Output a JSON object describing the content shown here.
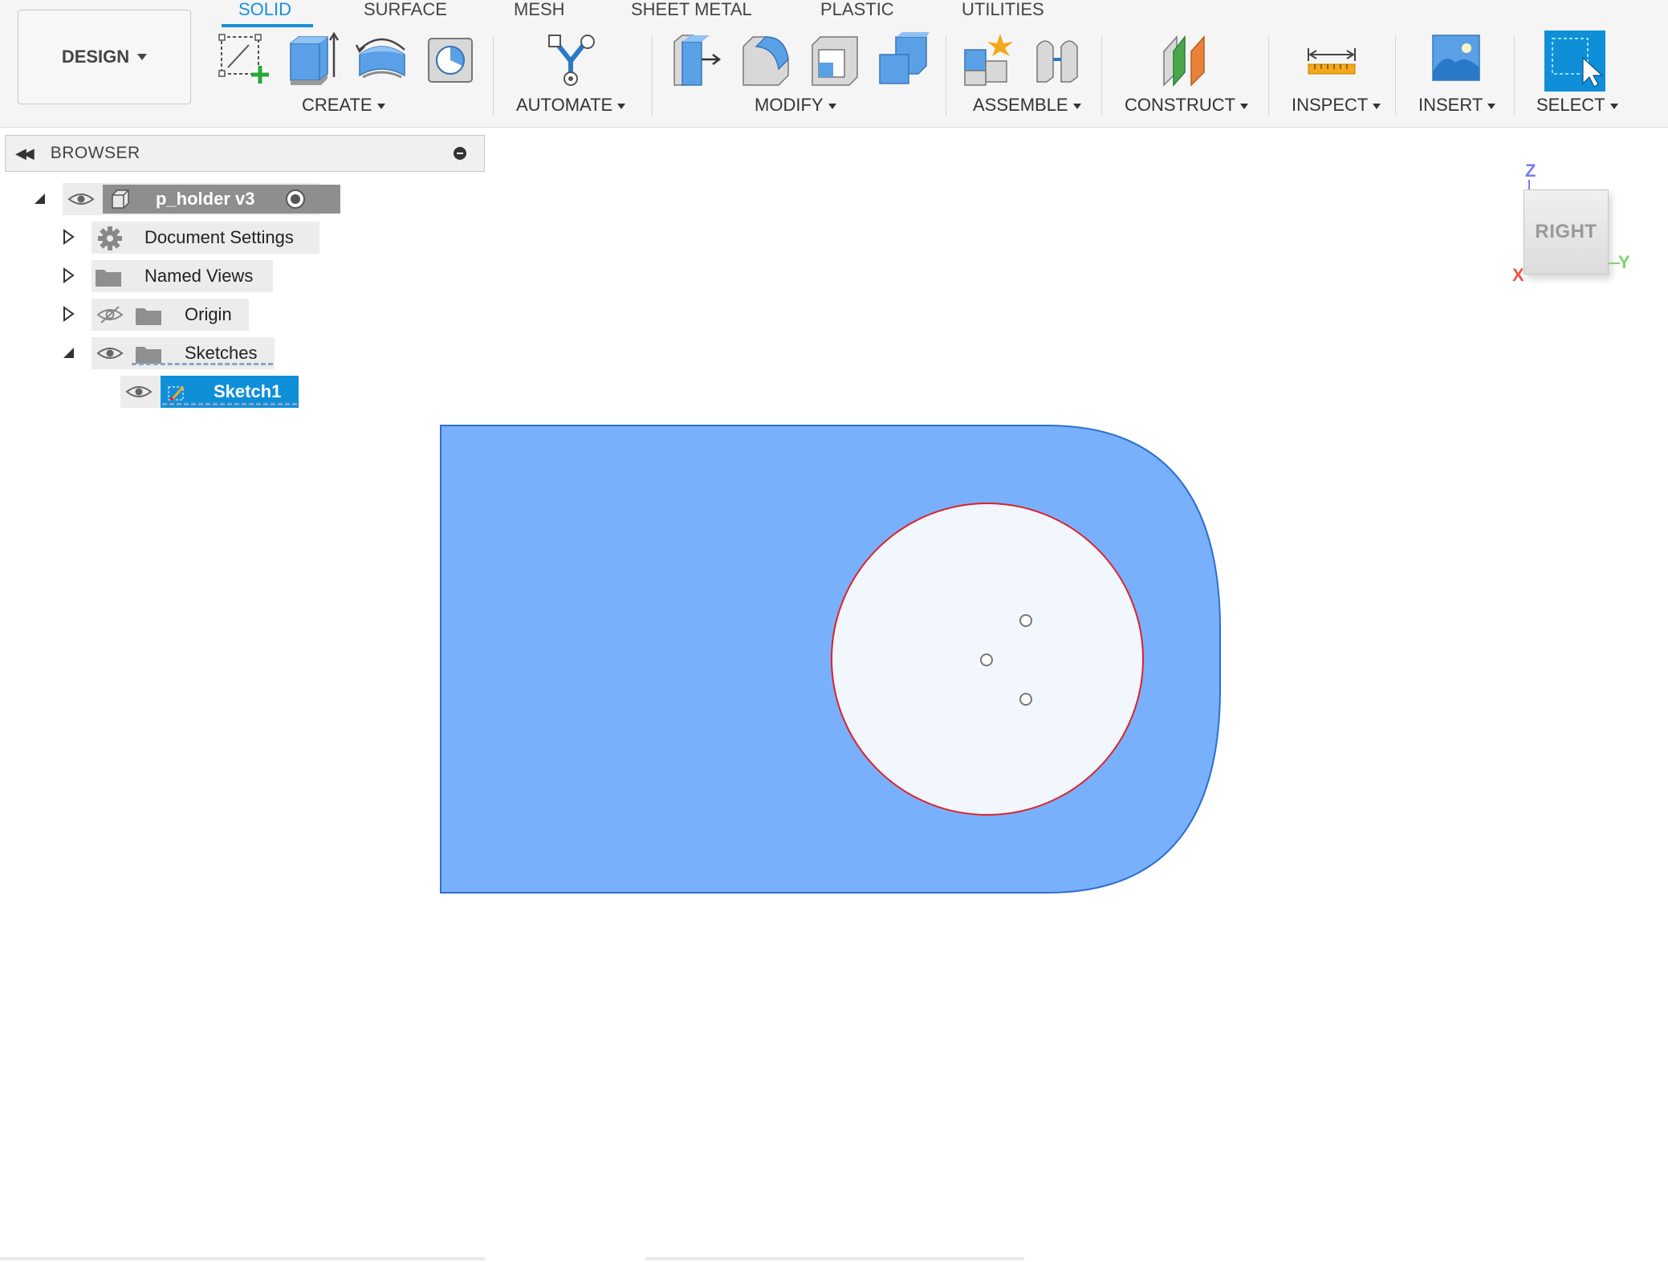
{
  "toolbar": {
    "design_label": "DESIGN",
    "tabs": [
      {
        "label": "SOLID",
        "active": true
      },
      {
        "label": "SURFACE"
      },
      {
        "label": "MESH"
      },
      {
        "label": "SHEET METAL"
      },
      {
        "label": "PLASTIC"
      },
      {
        "label": "UTILITIES"
      }
    ],
    "groups": {
      "create": "CREATE",
      "automate": "AUTOMATE",
      "modify": "MODIFY",
      "assemble": "ASSEMBLE",
      "construct": "CONSTRUCT",
      "inspect": "INSPECT",
      "insert": "INSERT",
      "select": "SELECT"
    },
    "icons": {
      "create": [
        "create-sketch-icon",
        "extrude-icon",
        "revolve-icon",
        "hole-icon"
      ],
      "automate": [
        "automate-icon"
      ],
      "modify": [
        "press-pull-icon",
        "fillet-icon",
        "shell-icon",
        "combine-icon"
      ],
      "assemble": [
        "new-component-icon",
        "joint-icon"
      ],
      "construct": [
        "construct-plane-icon"
      ],
      "inspect": [
        "measure-icon"
      ],
      "insert": [
        "insert-image-icon"
      ],
      "select": [
        "select-icon"
      ]
    }
  },
  "browser": {
    "title": "BROWSER",
    "root": "p_holder v3",
    "items": [
      {
        "label": "Document Settings",
        "icon": "gear-icon"
      },
      {
        "label": "Named Views",
        "icon": "folder-icon"
      },
      {
        "label": "Origin",
        "icon": "folder-icon"
      },
      {
        "label": "Sketches",
        "icon": "folder-icon"
      }
    ],
    "sketch": "Sketch1"
  },
  "viewcube": {
    "face": "RIGHT",
    "axes": {
      "z": "Z",
      "y": "Y",
      "x": "X"
    }
  },
  "colors": {
    "accent": "#1a8fd8",
    "profile_fill": "#78b0fb",
    "profile_stroke": "#2f6fd0",
    "circle_stroke": "#e0202a",
    "circle_fill": "#f1f7fc",
    "selected_row": "#0f8fd8"
  }
}
